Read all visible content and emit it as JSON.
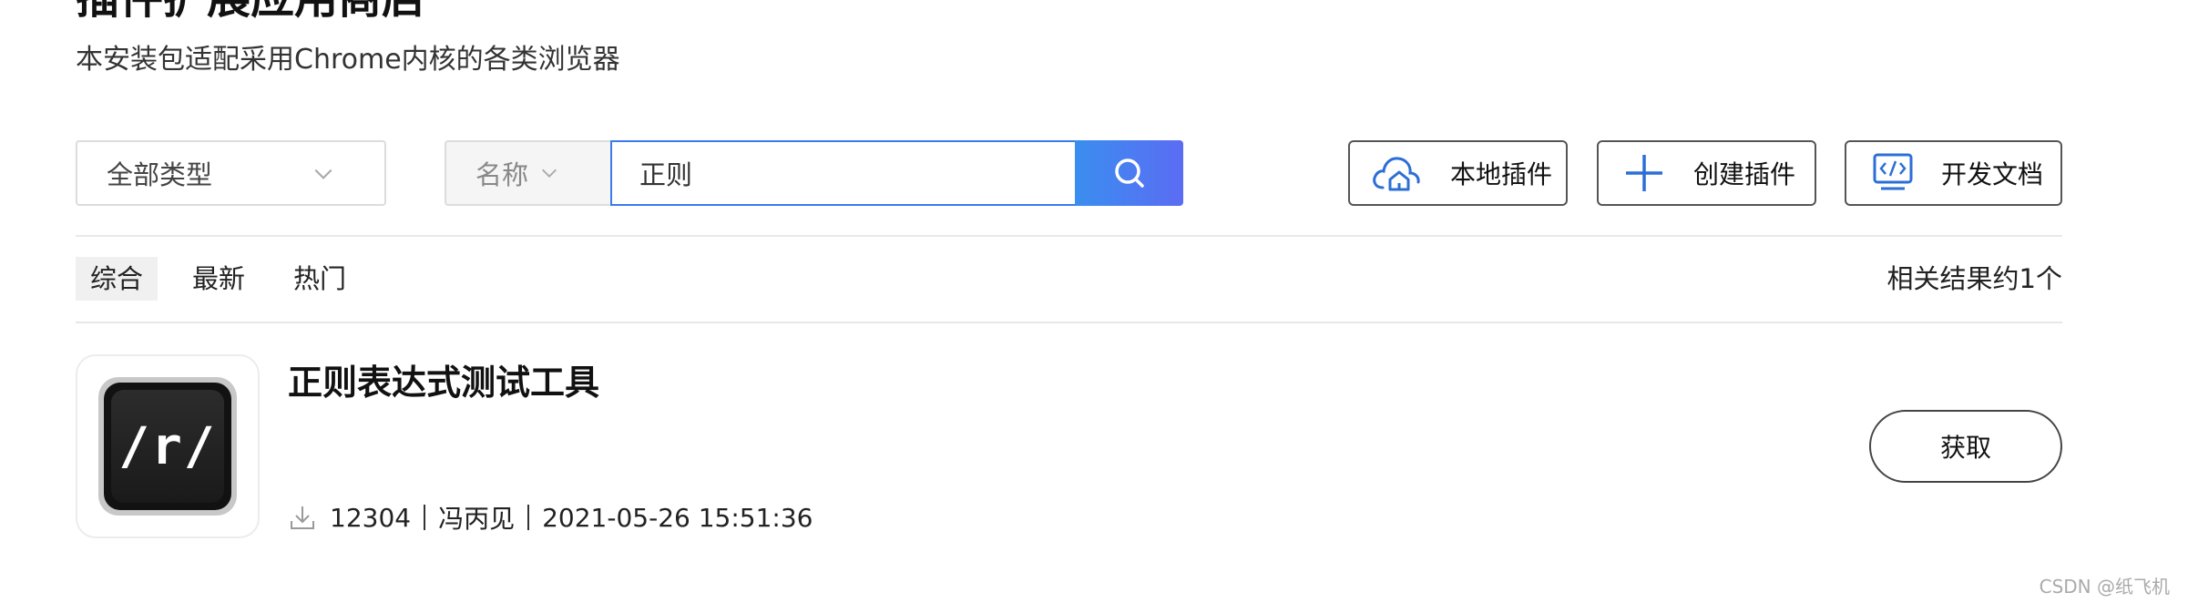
{
  "header": {
    "title": "插件扩展应用商店",
    "subtitle": "本安装包适配采用Chrome内核的各类浏览器"
  },
  "filters": {
    "type_select": "全部类型",
    "field_select": "名称",
    "search_value": "正则"
  },
  "actions": {
    "local_plugins": "本地插件",
    "create_plugin": "创建插件",
    "dev_docs": "开发文档"
  },
  "tabs": [
    {
      "label": "综合",
      "active": true
    },
    {
      "label": "最新",
      "active": false
    },
    {
      "label": "热门",
      "active": false
    }
  ],
  "result_count": "相关结果约1个",
  "results": [
    {
      "logo_text": "/r/",
      "name": "正则表达式测试工具",
      "downloads": "12304",
      "author": "冯丙见",
      "date": "2021-05-26 15:51:36",
      "get_label": "获取"
    }
  ],
  "watermark": "CSDN @纸飞机",
  "colors": {
    "accent": "#3b7bec",
    "search_gradient_start": "#3a8ef0",
    "search_gradient_end": "#5b6cf3"
  }
}
